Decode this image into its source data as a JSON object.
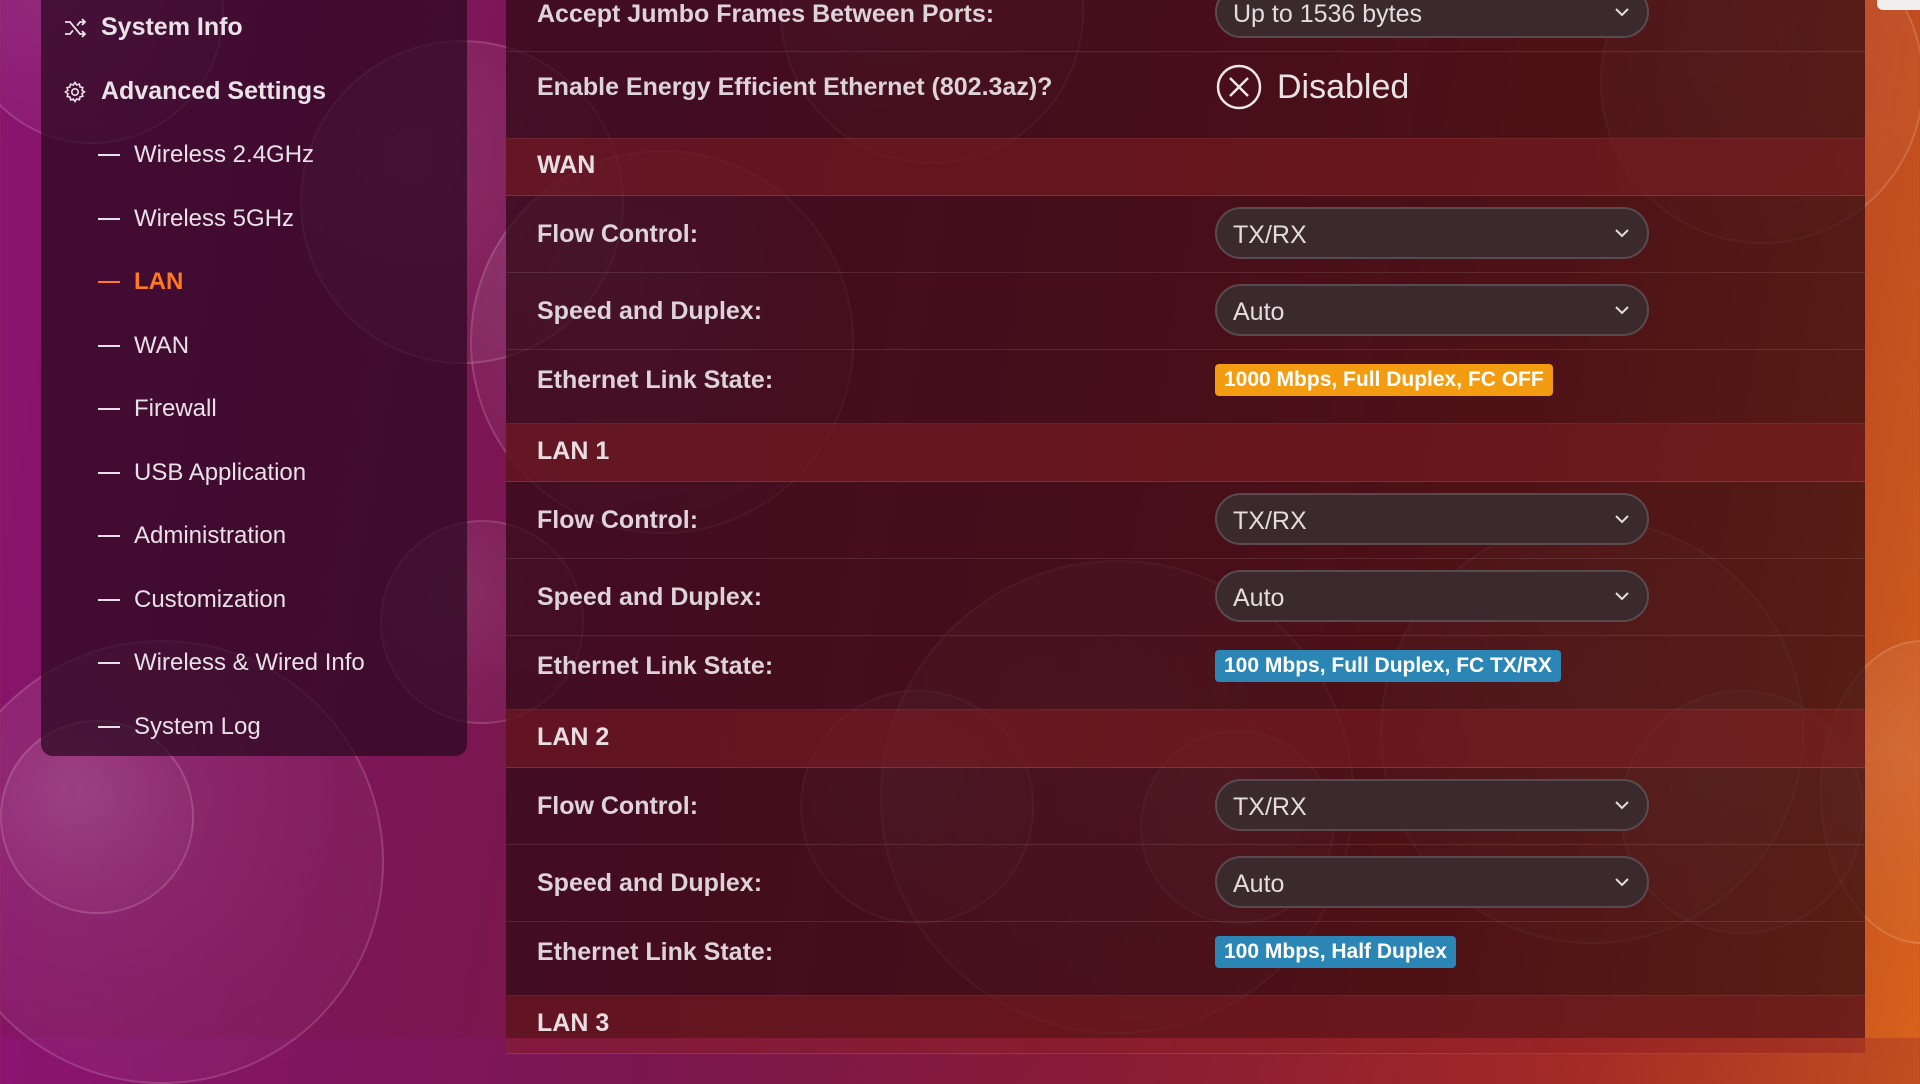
{
  "sidebar": {
    "system_info": "System Info",
    "advanced_settings": "Advanced Settings",
    "items": [
      {
        "label": "Wireless 2.4GHz"
      },
      {
        "label": "Wireless 5GHz"
      },
      {
        "label": "LAN",
        "active": true
      },
      {
        "label": "WAN"
      },
      {
        "label": "Firewall"
      },
      {
        "label": "USB Application"
      },
      {
        "label": "Administration"
      },
      {
        "label": "Customization"
      },
      {
        "label": "Wireless & Wired Info"
      },
      {
        "label": "System Log"
      }
    ]
  },
  "main": {
    "jumbo": {
      "label": "Accept Jumbo Frames Between Ports:",
      "value": "Up to 1536 bytes"
    },
    "eee": {
      "label": "Enable Energy Efficient Ethernet (802.3az)?",
      "value": "Disabled"
    },
    "field_labels": {
      "flow": "Flow Control:",
      "speed": "Speed and Duplex:",
      "link": "Ethernet Link State:"
    },
    "sections": [
      {
        "title": "WAN",
        "flow": "TX/RX",
        "speed": "Auto",
        "link": "1000 Mbps, Full Duplex, FC OFF",
        "link_color": "#f39c12"
      },
      {
        "title": "LAN 1",
        "flow": "TX/RX",
        "speed": "Auto",
        "link": "100 Mbps, Full Duplex, FC TX/RX",
        "link_color": "#2c86b5"
      },
      {
        "title": "LAN 2",
        "flow": "TX/RX",
        "speed": "Auto",
        "link": "100 Mbps, Half Duplex",
        "link_color": "#2c86b5"
      },
      {
        "title": "LAN 3"
      }
    ]
  }
}
